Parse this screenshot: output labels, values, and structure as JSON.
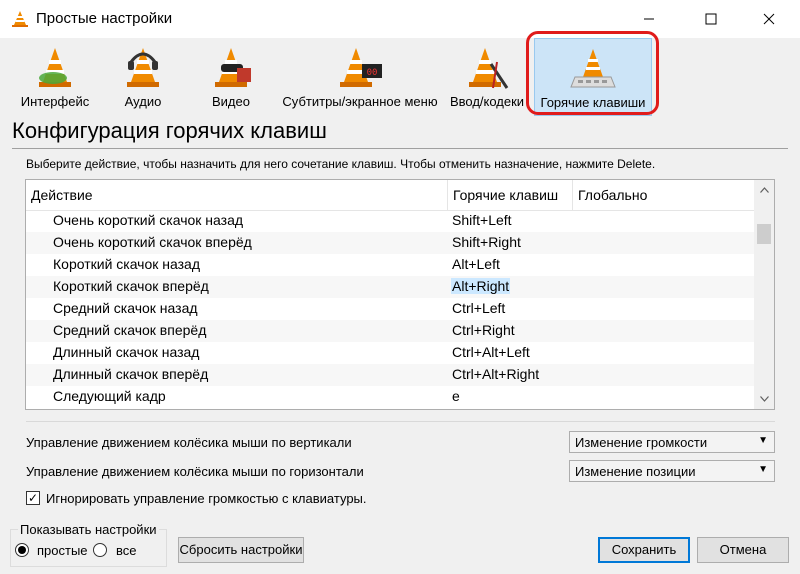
{
  "window": {
    "title": "Простые настройки"
  },
  "categories": [
    {
      "label": "Интерфейс",
      "icon": "interface-cone-icon"
    },
    {
      "label": "Аудио",
      "icon": "audio-cone-icon"
    },
    {
      "label": "Видео",
      "icon": "video-cone-icon"
    },
    {
      "label": "Субтитры/экранное меню",
      "icon": "subtitles-cone-icon"
    },
    {
      "label": "Ввод/кодеки",
      "icon": "input-codecs-cone-icon"
    },
    {
      "label": "Горячие клавиши",
      "icon": "hotkeys-cone-icon",
      "active": true
    }
  ],
  "page": {
    "title": "Конфигурация горячих клавиш",
    "hint": "Выберите действие, чтобы назначить для него сочетание клавиш. Чтобы отменить назначение, нажмите Delete."
  },
  "table": {
    "headers": [
      "Действие",
      "Горячие клавиш",
      "Глобально"
    ],
    "rows": [
      {
        "action": "Очень короткий скачок назад",
        "hotkey": "Shift+Left"
      },
      {
        "action": "Очень короткий скачок вперёд",
        "hotkey": "Shift+Right"
      },
      {
        "action": "Короткий скачок назад",
        "hotkey": "Alt+Left"
      },
      {
        "action": "Короткий скачок вперёд",
        "hotkey": "Alt+Right",
        "selected": true
      },
      {
        "action": "Средний скачок назад",
        "hotkey": "Ctrl+Left"
      },
      {
        "action": "Средний скачок вперёд",
        "hotkey": "Ctrl+Right"
      },
      {
        "action": "Длинный скачок назад",
        "hotkey": "Ctrl+Alt+Left"
      },
      {
        "action": "Длинный скачок вперёд",
        "hotkey": "Ctrl+Alt+Right"
      },
      {
        "action": "Следующий кадр",
        "hotkey": "e"
      }
    ]
  },
  "mouse": {
    "vertical_label": "Управление движением колёсика мыши по вертикали",
    "vertical_value": "Изменение громкости",
    "horizontal_label": "Управление движением колёсика мыши по горизонтали",
    "horizontal_value": "Изменение позиции"
  },
  "ignore_volume": {
    "label": "Игнорировать управление громкостью с клавиатуры.",
    "checked": true
  },
  "show_settings": {
    "legend": "Показывать настройки",
    "simple": "простые",
    "all": "все"
  },
  "buttons": {
    "reset": "Сбросить настройки",
    "save": "Сохранить",
    "cancel": "Отмена"
  },
  "colors": {
    "accent": "#0078d7",
    "selection": "#cce8ff",
    "highlight_ring": "#e01b1b",
    "cone_orange": "#f08a00"
  }
}
